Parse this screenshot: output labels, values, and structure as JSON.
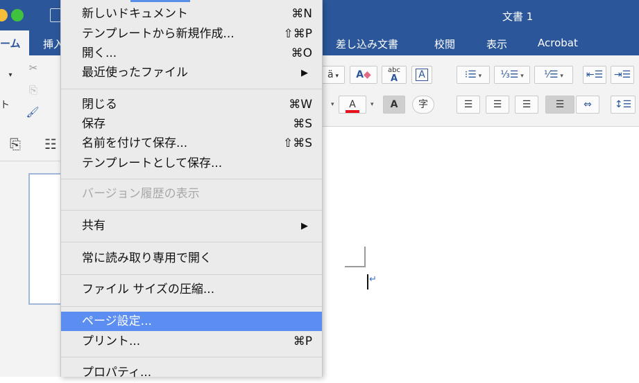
{
  "window": {
    "title": "文書 1"
  },
  "ribbon_tabs": {
    "home": "ーム",
    "insert": "挿入",
    "mailings": "差し込み文書",
    "review": "校閲",
    "view": "表示",
    "acrobat": "Acrobat"
  },
  "ribbon": {
    "paste_label": "ト",
    "text_effects_glyph": "A",
    "abc_glyph": "abc",
    "char_border_glyph": "A",
    "font_color_glyph": "A",
    "highlight_glyph": "A",
    "enclose_glyph": "字",
    "change_case_glyph": "ä",
    "colors": {
      "font_color": "#e8101b",
      "ribbon_blue": "#2b579a"
    }
  },
  "file_menu": {
    "items": [
      {
        "label": "新しいドキュメント",
        "shortcut": "⌘N"
      },
      {
        "label": "テンプレートから新規作成...",
        "shortcut": "⇧⌘P"
      },
      {
        "label": "開く...",
        "shortcut": "⌘O"
      },
      {
        "label": "最近使ったファイル",
        "shortcut": "▶"
      },
      {
        "label": "閉じる",
        "shortcut": "⌘W"
      },
      {
        "label": "保存",
        "shortcut": "⌘S"
      },
      {
        "label": "名前を付けて保存...",
        "shortcut": "⇧⌘S"
      },
      {
        "label": "テンプレートとして保存...",
        "shortcut": ""
      },
      {
        "label": "バージョン履歴の表示",
        "shortcut": ""
      },
      {
        "label": "共有",
        "shortcut": "▶"
      },
      {
        "label": "常に読み取り専用で開く",
        "shortcut": ""
      },
      {
        "label": "ファイル サイズの圧縮...",
        "shortcut": ""
      },
      {
        "label": "ページ設定...",
        "shortcut": ""
      },
      {
        "label": "プリント...",
        "shortcut": "⌘P"
      },
      {
        "label": "プロパティ...",
        "shortcut": ""
      }
    ]
  },
  "document": {
    "paragraph_mark": "↵"
  }
}
